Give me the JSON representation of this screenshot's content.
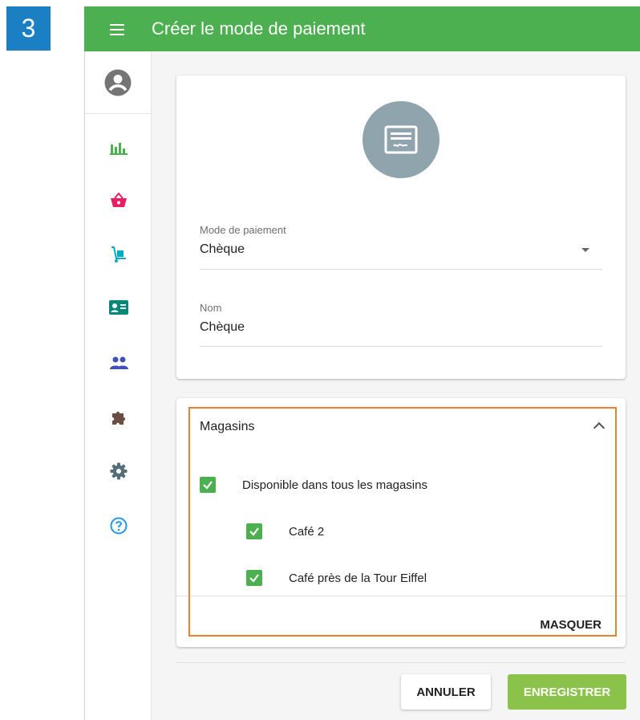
{
  "step_badge": "3",
  "topbar": {
    "title": "Créer le mode de paiement"
  },
  "sidebar": {
    "items": [
      {
        "name": "stats",
        "icon": "bar-chart-icon",
        "color": "#4caf50"
      },
      {
        "name": "basket",
        "icon": "basket-icon",
        "color": "#e91e63"
      },
      {
        "name": "delivery",
        "icon": "hand-truck-icon",
        "color": "#00acc1"
      },
      {
        "name": "contacts",
        "icon": "id-card-icon",
        "color": "#00897b"
      },
      {
        "name": "users",
        "icon": "people-icon",
        "color": "#3f51b5"
      },
      {
        "name": "plugins",
        "icon": "puzzle-icon",
        "color": "#6d4c41"
      },
      {
        "name": "settings",
        "icon": "gear-icon",
        "color": "#546e7a"
      },
      {
        "name": "help",
        "icon": "help-circle-icon",
        "color": "#2196f3"
      }
    ]
  },
  "form": {
    "payment_mode": {
      "label": "Mode de paiement",
      "value": "Chèque"
    },
    "name": {
      "label": "Nom",
      "value": "Chèque"
    }
  },
  "shops": {
    "title": "Magasins",
    "all_label": "Disponible dans tous les magasins",
    "items": [
      {
        "label": "Café 2",
        "checked": true
      },
      {
        "label": "Café près de la Tour Eiffel",
        "checked": true
      }
    ],
    "hide_label": "MASQUER"
  },
  "actions": {
    "cancel": "ANNULER",
    "save": "ENREGISTRER"
  },
  "colors": {
    "primary": "#4caf50",
    "save_button": "#8bc34a",
    "highlight": "#e8822e",
    "badge": "#1b7fc4"
  }
}
